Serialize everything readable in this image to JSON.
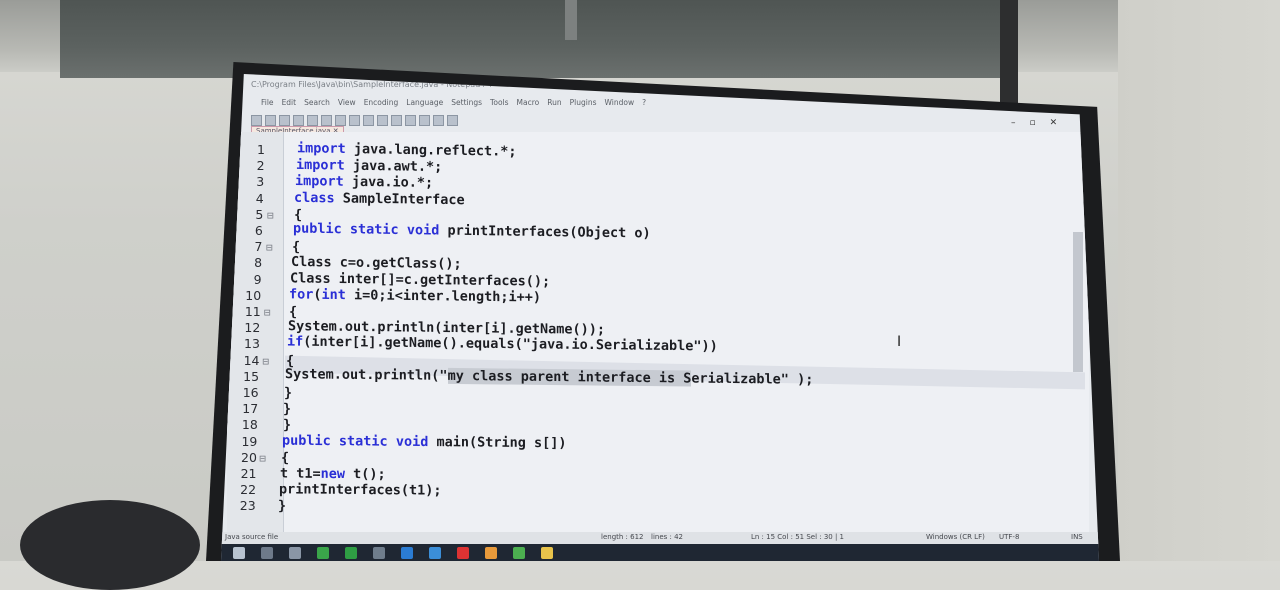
{
  "window": {
    "title": "C:\\Program Files\\Java\\bin\\SampleInterface.java - Notepad++",
    "menu": [
      "File",
      "Edit",
      "Search",
      "View",
      "Encoding",
      "Language",
      "Settings",
      "Tools",
      "Macro",
      "Run",
      "Plugins",
      "Window",
      "?"
    ],
    "tab_label": "SampleInterface.java"
  },
  "editor": {
    "lines": [
      {
        "n": "1",
        "code": "import java.lang.reflect.*;"
      },
      {
        "n": "2",
        "code": "import java.awt.*;"
      },
      {
        "n": "3",
        "code": "import java.io.*;"
      },
      {
        "n": "4",
        "code": "class SampleInterface"
      },
      {
        "n": "5",
        "code": "{"
      },
      {
        "n": "6",
        "code": "public static void printInterfaces(Object o)"
      },
      {
        "n": "7",
        "code": "{"
      },
      {
        "n": "8",
        "code": "Class c=o.getClass();"
      },
      {
        "n": "9",
        "code": "Class inter[]=c.getInterfaces();"
      },
      {
        "n": "10",
        "code": "for(int i=0;i<inter.length;i++)"
      },
      {
        "n": "11",
        "code": "{"
      },
      {
        "n": "12",
        "code": "System.out.println(inter[i].getName());"
      },
      {
        "n": "13",
        "code": "if(inter[i].getName().equals(\"java.io.Serializable\"))"
      },
      {
        "n": "14",
        "code": "{"
      },
      {
        "n": "15",
        "code": "System.out.println(\"my class parent interface is Serializable\" );"
      },
      {
        "n": "16",
        "code": "}"
      },
      {
        "n": "17",
        "code": "}"
      },
      {
        "n": "18",
        "code": "}"
      },
      {
        "n": "19",
        "code": "public static void main(String s[])"
      },
      {
        "n": "20",
        "code": "{"
      },
      {
        "n": "21",
        "code": "t t1=new t();"
      },
      {
        "n": "22",
        "code": "printInterfaces(t1);"
      },
      {
        "n": "23",
        "code": "}"
      }
    ]
  },
  "status": {
    "file_type": "Java source file",
    "length": "length : 612",
    "lines": "lines : 42",
    "position": "Ln : 15   Col : 51   Sel : 30 | 1",
    "eol": "Windows (CR LF)",
    "encoding": "UTF-8",
    "mode": "INS"
  },
  "colors": {
    "keyword": "#2a2fd6",
    "taskbar": "#1f2733"
  }
}
